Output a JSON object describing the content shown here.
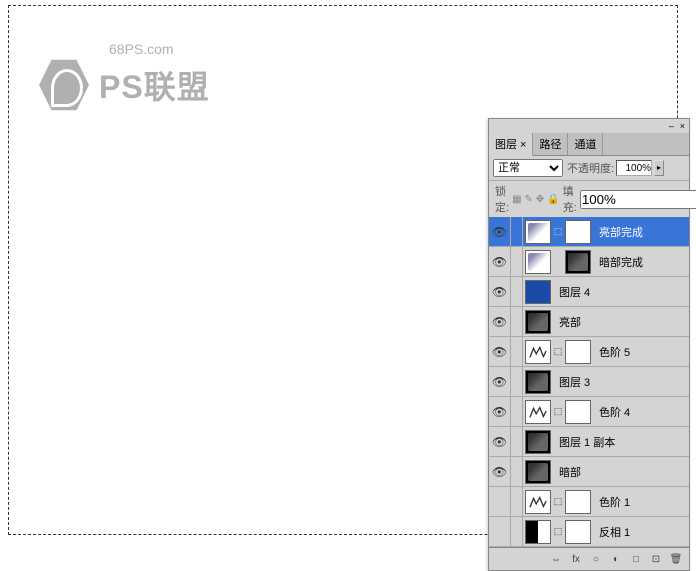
{
  "watermark": {
    "url": "68PS.com",
    "text": "PS联盟"
  },
  "panel": {
    "tabs": [
      "图层 ×",
      "路径",
      "通道"
    ],
    "blend_mode": "正常",
    "opacity_label": "不透明度:",
    "opacity_value": "100%",
    "lock_label": "锁定:",
    "fill_label": "填充:",
    "fill_value": "100%"
  },
  "layers": [
    {
      "name": "亮部完成",
      "visible": true,
      "selected": true,
      "thumb": "ice",
      "mask": "white",
      "linked": true
    },
    {
      "name": "暗部完成",
      "visible": true,
      "thumb": "ice",
      "mask": "black-pattern"
    },
    {
      "name": "图层 4",
      "visible": true,
      "thumb": "blue"
    },
    {
      "name": "亮部",
      "visible": true,
      "thumb": "dark-pattern"
    },
    {
      "name": "色阶 5",
      "visible": true,
      "thumb": "levels",
      "mask": "white",
      "linked": true
    },
    {
      "name": "图层 3",
      "visible": true,
      "thumb": "dark-pattern"
    },
    {
      "name": "色阶 4",
      "visible": true,
      "thumb": "levels",
      "mask": "white",
      "linked": true
    },
    {
      "name": "图层 1 副本",
      "visible": true,
      "thumb": "dark-pattern"
    },
    {
      "name": "暗部",
      "visible": true,
      "thumb": "dark-pattern"
    },
    {
      "name": "色阶 1",
      "visible": false,
      "thumb": "levels",
      "mask": "white",
      "linked": true
    },
    {
      "name": "反相 1",
      "visible": false,
      "thumb": "invert",
      "mask": "white",
      "linked": true
    }
  ],
  "bottom_icons": [
    "⇔",
    "fx",
    "○",
    "◐",
    "□",
    "⊡",
    "🗑"
  ]
}
